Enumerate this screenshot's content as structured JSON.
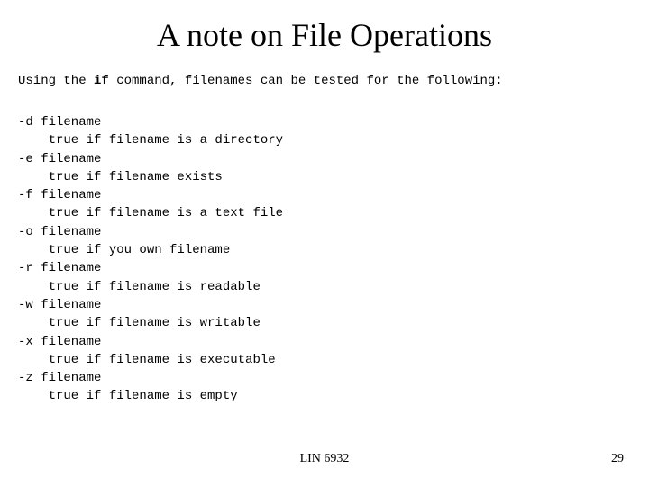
{
  "title": "A note on File Operations",
  "intro_pre": "Using the ",
  "intro_bold": "if",
  "intro_post": " command, filenames can be tested for the following:",
  "options_block": "-d filename\n    true if filename is a directory\n-e filename\n    true if filename exists\n-f filename\n    true if filename is a text file\n-o filename\n    true if you own filename\n-r filename\n    true if filename is readable\n-w filename\n    true if filename is writable\n-x filename\n    true if filename is executable\n-z filename\n    true if filename is empty",
  "footer_center": "LIN 6932",
  "footer_page": "29"
}
